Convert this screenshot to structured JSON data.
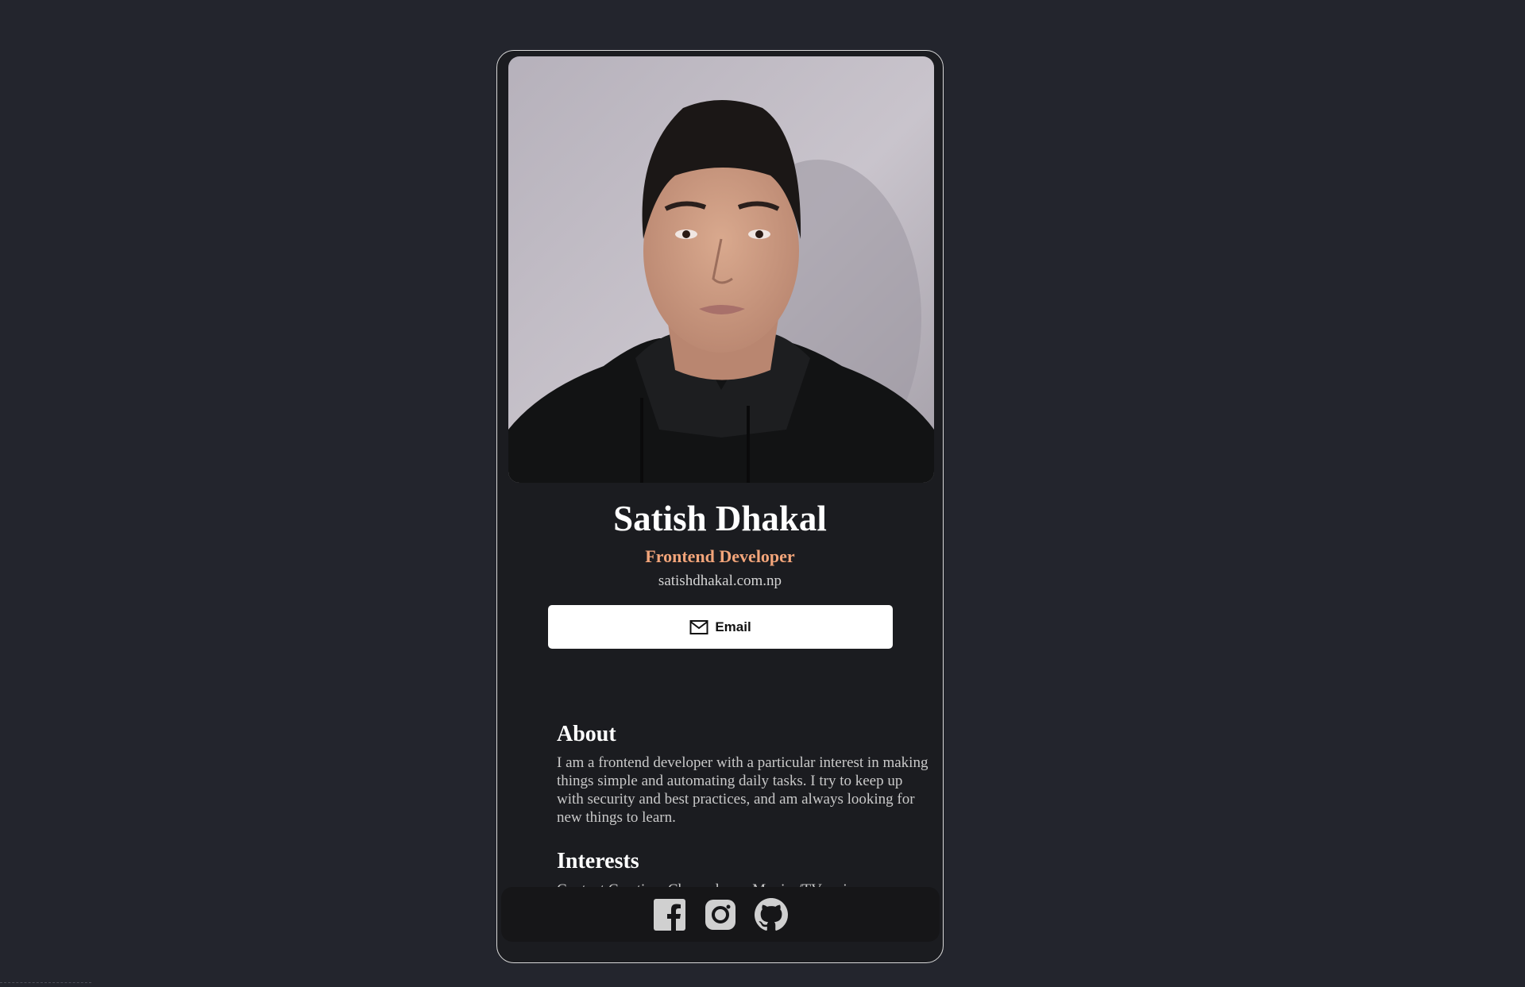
{
  "profile": {
    "photo_alt": "Profile photo",
    "name": "Satish Dhakal",
    "title": "Frontend Developer",
    "website": "satishdhakal.com.np",
    "email_label": "Email"
  },
  "about": {
    "heading": "About",
    "text": "I am a frontend developer with a particular interest in making things simple and automating daily tasks. I try to keep up with security and best practices, and am always looking for new things to learn."
  },
  "interests": {
    "heading": "Interests",
    "text": "Content Creation, Chess player, Movies/TV series, Travelling, Fitness/Bodybuilding, Puzzles, Coding."
  },
  "footer": {
    "icons": [
      "facebook-icon",
      "instagram-icon",
      "github-icon"
    ]
  },
  "colors": {
    "page_bg": "#23252d",
    "card_bg": "#1b1c20",
    "accent": "#f3a57a",
    "footer_bg": "#161618",
    "icon": "#d0d0d0"
  }
}
